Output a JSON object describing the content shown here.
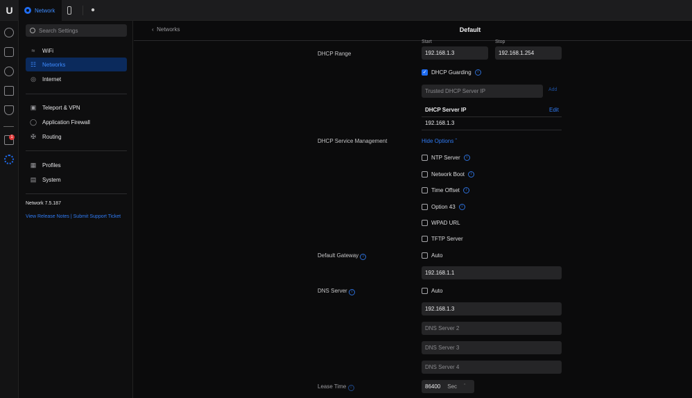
{
  "topbar": {
    "app": "Network"
  },
  "rail": {
    "notifications_badge": "1"
  },
  "sidebar": {
    "search_placeholder": "Search Settings",
    "items": [
      {
        "label": "WiFi"
      },
      {
        "label": "Networks"
      },
      {
        "label": "Internet"
      },
      {
        "label": "Teleport & VPN"
      },
      {
        "label": "Application Firewall"
      },
      {
        "label": "Routing"
      },
      {
        "label": "Profiles"
      },
      {
        "label": "System"
      }
    ],
    "version": "Network 7.5.187",
    "release_notes": "View Release Notes",
    "divider": "|",
    "support": "Submit Support Ticket"
  },
  "header": {
    "back": "Networks",
    "title": "Default"
  },
  "form": {
    "dhcp_range": {
      "label": "DHCP Range",
      "start_label": "Start",
      "start": "192.168.1.3",
      "stop_label": "Stop",
      "stop": "192.168.1.254"
    },
    "guarding": {
      "label": "DHCP Guarding",
      "checked": true,
      "trusted_placeholder": "Trusted DHCP Server IP",
      "add": "Add",
      "server_ip_header": "DHCP Server IP",
      "edit": "Edit",
      "server_ip": "192.168.1.3"
    },
    "service_mgmt": {
      "label": "DHCP Service Management",
      "toggle": "Hide Options",
      "options": [
        "NTP Server",
        "Network Boot",
        "Time Offset",
        "Option 43",
        "WPAD URL",
        "TFTP Server"
      ]
    },
    "gateway": {
      "label": "Default Gateway",
      "auto": "Auto",
      "value": "192.168.1.1"
    },
    "dns": {
      "label": "DNS Server",
      "auto": "Auto",
      "value": "192.168.1.3",
      "placeholders": [
        "DNS Server 2",
        "DNS Server 3",
        "DNS Server 4"
      ]
    },
    "lease": {
      "label": "Lease Time",
      "value": "86400",
      "unit": "Sec"
    }
  }
}
